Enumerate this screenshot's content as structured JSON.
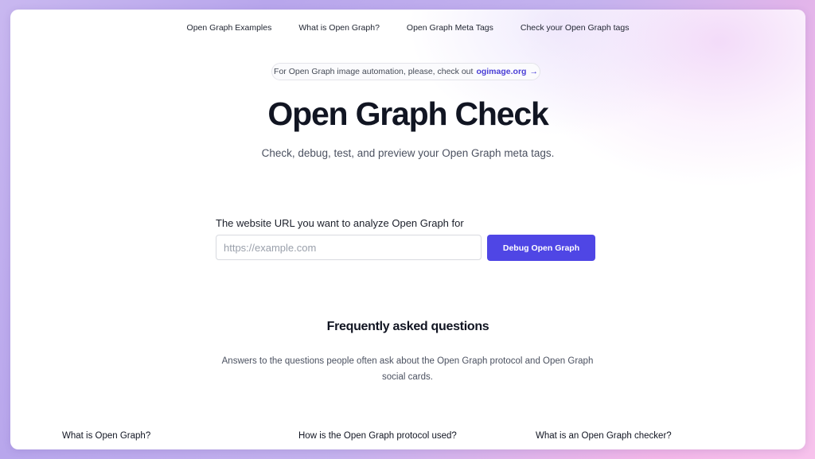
{
  "nav": {
    "items": [
      {
        "label": "Open Graph Examples"
      },
      {
        "label": "What is Open Graph?"
      },
      {
        "label": "Open Graph Meta Tags"
      },
      {
        "label": "Check your Open Graph tags"
      }
    ]
  },
  "banner": {
    "text": "For Open Graph image automation, please, check out",
    "link_label": "ogimage.org",
    "arrow": "→"
  },
  "hero": {
    "title": "Open Graph Check",
    "subtitle": "Check, debug, test, and preview your Open Graph meta tags."
  },
  "form": {
    "label": "The website URL you want to analyze Open Graph for",
    "input_value": "",
    "input_placeholder": "https://example.com",
    "button_label": "Debug Open Graph"
  },
  "faq": {
    "title": "Frequently asked questions",
    "description": "Answers to the questions people often ask about the Open Graph protocol and Open Graph social cards.",
    "questions": [
      {
        "q": "What is Open Graph?"
      },
      {
        "q": "How is the Open Graph protocol used?"
      },
      {
        "q": "What is an Open Graph checker?"
      }
    ]
  },
  "colors": {
    "accent": "#4f46e5",
    "link": "#4a3fd6",
    "heading": "#111522"
  }
}
